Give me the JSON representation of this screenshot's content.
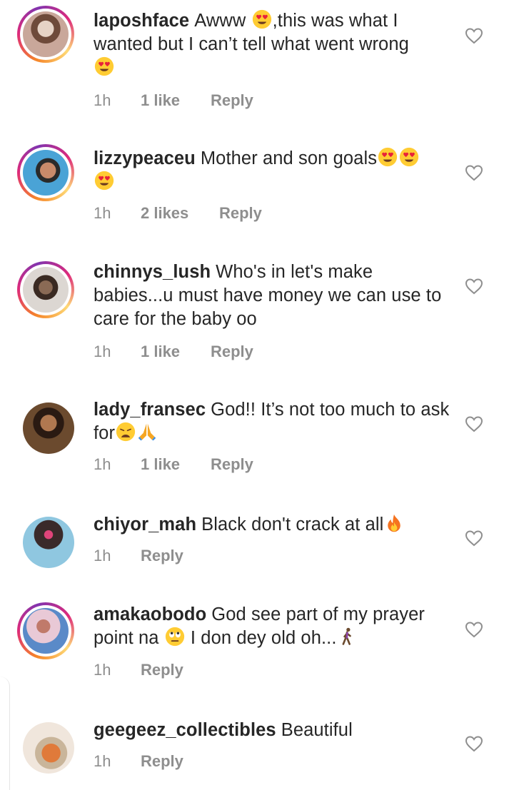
{
  "comments": [
    {
      "username": "laposhface",
      "text_parts": [
        "Awww ",
        ",this was what I wanted but I can’t tell what went wrong"
      ],
      "emojis": [
        "heart-eyes-emoji",
        "heart-eyes-emoji"
      ],
      "time": "1h",
      "likes": "1 like",
      "reply": "Reply",
      "story_ring": true,
      "avatar_colors": [
        "#c9a79a",
        "#6e4a3a",
        "#e6d3c6"
      ]
    },
    {
      "username": "lizzypeaceu",
      "text": "Mother and son goals",
      "emojis": [
        "heart-eyes-emoji",
        "heart-eyes-emoji",
        "heart-eyes-emoji"
      ],
      "time": "1h",
      "likes": "2 likes",
      "reply": "Reply",
      "story_ring": true,
      "avatar_colors": [
        "#4aa3d6",
        "#2a2a2a",
        "#c98a6a"
      ]
    },
    {
      "username": "chinnys_lush",
      "text": "Who's in let's make babies...u must have money we can use to care for the baby oo",
      "time": "1h",
      "likes": "1 like",
      "reply": "Reply",
      "story_ring": true,
      "avatar_colors": [
        "#dcd7d2",
        "#3a2a22",
        "#8a6a55"
      ]
    },
    {
      "username": "lady_fransec",
      "text_parts": [
        "God!! It’s not too much to ask for",
        ""
      ],
      "emojis": [
        "weary-face-emoji",
        "folded-hands-emoji"
      ],
      "time": "1h",
      "likes": "1 like",
      "reply": "Reply",
      "story_ring": false,
      "avatar_colors": [
        "#6b4a2e",
        "#2a1a12",
        "#b07850"
      ]
    },
    {
      "username": "chiyor_mah",
      "text": "Black don't crack at all",
      "emojis": [
        "fire-emoji"
      ],
      "time": "1h",
      "reply": "Reply",
      "story_ring": false,
      "avatar_colors": [
        "#8fc7e0",
        "#3a2a2a",
        "#e0447a"
      ]
    },
    {
      "username": "amakaobodo",
      "text_parts": [
        "God see part of my prayer point na ",
        " I don dey old oh..."
      ],
      "emojis": [
        "eye-roll-emoji",
        "walking-person-emoji"
      ],
      "time": "1h",
      "reply": "Reply",
      "story_ring": true,
      "avatar_colors": [
        "#e9c9d6",
        "#5a8ac8",
        "#c07a6a"
      ]
    },
    {
      "username": "geegeez_collectibles",
      "text": "Beautiful",
      "time": "1h",
      "reply": "Reply",
      "story_ring": false,
      "avatar_colors": [
        "#f0e6dc",
        "#e07a3a",
        "#c9b59a"
      ]
    }
  ],
  "icons": {
    "like": "heart-outline-icon"
  },
  "colors": {
    "text": "#262626",
    "meta": "#8e8e8e",
    "heart_outline": "#8e8e8e"
  }
}
